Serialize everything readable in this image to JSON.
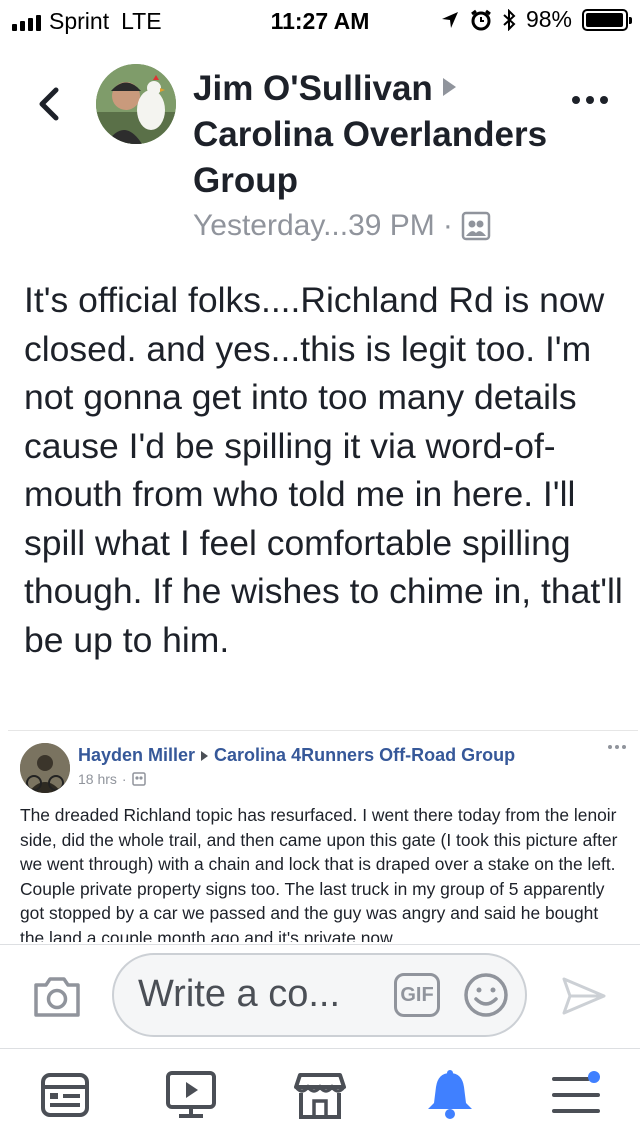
{
  "status_bar": {
    "carrier": "Sprint",
    "network": "LTE",
    "time": "11:27 AM",
    "battery_percent": "98%",
    "battery_level": 0.98
  },
  "post": {
    "author": "Jim O'Sullivan",
    "group": "Carolina Overlanders Group",
    "timestamp": "Yesterday...39 PM",
    "separator": "·",
    "body": "It's official folks....Richland Rd is now closed.  and yes...this is legit too. I'm not gonna get into too many details cause I'd be spilling it via word-of-mouth from who told me in here.  I'll spill what I feel comfortable spilling though.   If he wishes to chime in, that'll be up to him."
  },
  "embedded": {
    "author": "Hayden Miller",
    "group": "Carolina 4Runners Off-Road Group",
    "timestamp": "18 hrs",
    "separator": "·",
    "body": "The dreaded Richland topic has resurfaced. I went there today from the lenoir side, did the whole trail, and then came upon this gate (I took this picture after we went through) with a chain and lock that is draped over a stake on the left. Couple private property signs too. The last truck in my group of 5 apparently got stopped by a car we passed and the guy was angry and said he bought the land a couple month ago and it's private now"
  },
  "comment_bar": {
    "placeholder": "Write a co...",
    "gif_label": "GIF"
  },
  "icons": {
    "back": "chevron-left-icon",
    "more": "more-dots-icon",
    "audience": "group-icon",
    "camera": "camera-icon",
    "emoji": "smiley-icon",
    "send": "send-icon",
    "tabs": [
      "news-feed-icon",
      "watch-icon",
      "marketplace-icon",
      "notifications-icon",
      "menu-icon"
    ]
  },
  "colors": {
    "accent": "#4080ff",
    "link": "#365899",
    "muted": "#90949c"
  }
}
